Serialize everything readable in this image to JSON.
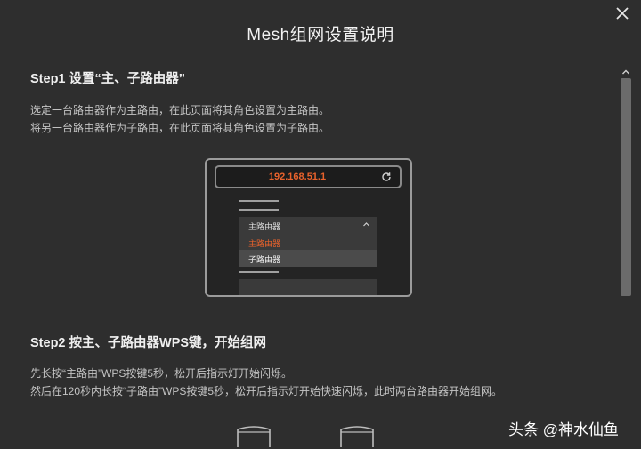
{
  "dialog": {
    "title": "Mesh组网设置说明",
    "close_icon": "close-icon"
  },
  "step1": {
    "heading": "Step1 设置“主、子路由器”",
    "line1": "选定一台路由器作为主路由，在此页面将其角色设置为主路由。",
    "line2": "将另一台路由器作为子路由，在此页面将其角色设置为子路由。"
  },
  "illustration": {
    "address": "192.168.51.1",
    "refresh_icon": "refresh-icon",
    "dropdown_selected": "主路由器",
    "chevron_icon": "chevron-up-icon",
    "options": [
      "主路由器",
      "子路由器"
    ],
    "accent_color": "#e8622c"
  },
  "step2": {
    "heading": "Step2 按主、子路由器WPS键，开始组网",
    "line1": "先长按“主路由”WPS按键5秒，松开后指示灯开始闪烁。",
    "line2": "然后在120秒内长按“子路由”WPS按键5秒，松开后指示灯开始快速闪烁，此时两台路由器开始组网。"
  },
  "watermark": {
    "text": "头条 @神水仙鱼"
  },
  "scrollbar": {
    "up_icon": "chevron-up-icon"
  }
}
